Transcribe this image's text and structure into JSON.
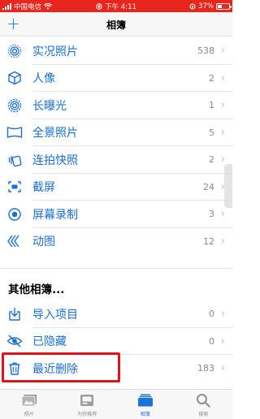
{
  "status_bar": {
    "carrier": "中国电信",
    "time": "下午 4:11",
    "battery": "37%",
    "battery_level": 0.37
  },
  "nav": {
    "add_label": "+",
    "title": "相簿"
  },
  "media_types": [
    {
      "label": "实况照片",
      "count": "538",
      "icon": "live-photo-icon"
    },
    {
      "label": "人像",
      "count": "2",
      "icon": "portrait-cube-icon"
    },
    {
      "label": "长曝光",
      "count": "1",
      "icon": "long-exposure-icon"
    },
    {
      "label": "全景照片",
      "count": "5",
      "icon": "panorama-icon"
    },
    {
      "label": "连拍快照",
      "count": "2",
      "icon": "burst-icon"
    },
    {
      "label": "截屏",
      "count": "24",
      "icon": "screenshot-icon"
    },
    {
      "label": "屏幕录制",
      "count": "3",
      "icon": "screen-recording-icon"
    },
    {
      "label": "动图",
      "count": "12",
      "icon": "animated-icon"
    }
  ],
  "other_section": {
    "heading": "其他相簿...",
    "items": [
      {
        "label": "导入项目",
        "count": "0",
        "icon": "import-icon"
      },
      {
        "label": "已隐藏",
        "count": "0",
        "icon": "hidden-eye-icon"
      },
      {
        "label": "最近删除",
        "count": "183",
        "icon": "trash-icon"
      }
    ]
  },
  "tab_bar": [
    {
      "label": "照片",
      "icon": "photos-tab-icon",
      "active": false
    },
    {
      "label": "为你推荐",
      "icon": "for-you-tab-icon",
      "active": false
    },
    {
      "label": "相簿",
      "icon": "albums-tab-icon",
      "active": true
    },
    {
      "label": "搜索",
      "icon": "search-tab-icon",
      "active": false
    }
  ],
  "colors": {
    "accent": "#1a6fd6",
    "status_bar": "#e8261e",
    "highlight": "#e0131a"
  }
}
